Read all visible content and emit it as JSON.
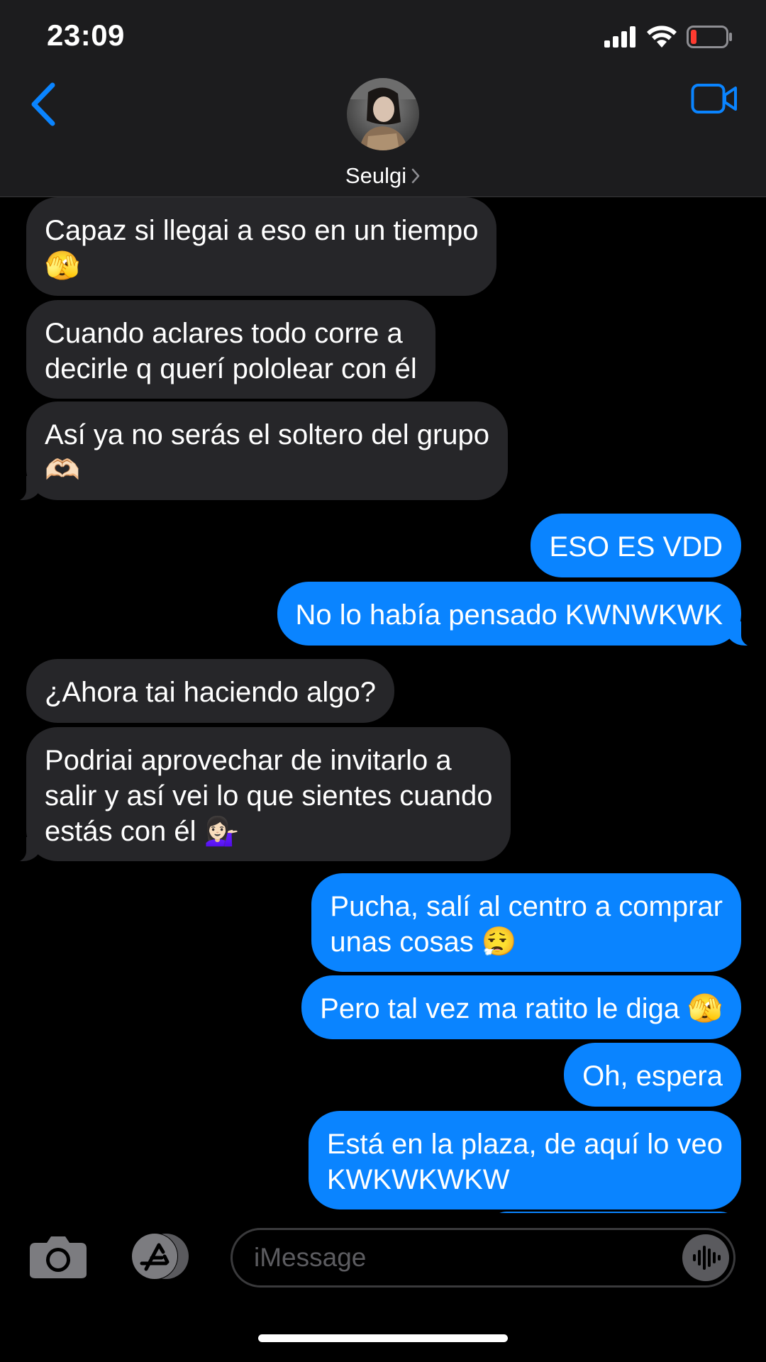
{
  "status_bar": {
    "time": "23:09",
    "signal_icon": "cellular-signal-icon",
    "wifi_icon": "wifi-icon",
    "battery_icon": "battery-low-icon"
  },
  "header": {
    "back_icon": "chevron-left-icon",
    "contact_name": "Seulgi",
    "contact_chevron": "›",
    "video_icon": "video-camera-icon"
  },
  "colors": {
    "accent": "#0a84ff",
    "incoming_bubble": "#262629",
    "header_bg": "#1c1c1e",
    "battery_low": "#ff3b30"
  },
  "messages": [
    {
      "direction": "incoming",
      "text": "Capaz si llegai a eso en un tiempo\n🫣"
    },
    {
      "direction": "incoming",
      "text": "Cuando aclares todo corre a\ndecirle q querí pololear con él"
    },
    {
      "direction": "incoming",
      "text": "Así ya no serás el soltero del grupo\n🫶🏻"
    },
    {
      "direction": "outgoing",
      "text": "ESO ES VDD"
    },
    {
      "direction": "outgoing",
      "text": "No lo había pensado KWNWKWK"
    },
    {
      "direction": "incoming",
      "text": "¿Ahora tai haciendo algo?"
    },
    {
      "direction": "incoming",
      "text": "Podriai aprovechar de invitarlo a\nsalir y así vei lo que sientes cuando\nestás con él 💁🏻‍♀️"
    },
    {
      "direction": "outgoing",
      "text": "Pucha, salí al centro a comprar\nunas cosas 😮‍💨"
    },
    {
      "direction": "outgoing",
      "text": "Pero tal vez ma ratito le diga 🫣"
    },
    {
      "direction": "outgoing",
      "text": "Oh, espera"
    },
    {
      "direction": "outgoing",
      "text": "Está en la plaza, de aquí lo veo\nKWKWKWKW"
    }
  ],
  "input_bar": {
    "camera_icon": "camera-icon",
    "apps_icon": "app-store-icon",
    "placeholder": "iMessage",
    "audio_icon": "audio-waveform-icon"
  }
}
